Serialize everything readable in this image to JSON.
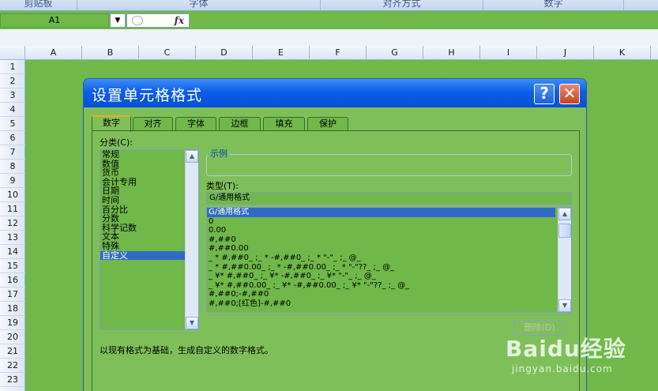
{
  "ribbon": {
    "groups": [
      "剪贴板",
      "字体",
      "对齐方式",
      "数字"
    ]
  },
  "formula_bar": {
    "name_box": "A1",
    "dropdown_icon": "▼",
    "fx_label": "fx"
  },
  "sheet": {
    "columns": [
      "A",
      "B",
      "C",
      "D",
      "E",
      "F",
      "G",
      "H",
      "I",
      "J",
      "K"
    ],
    "rows": [
      "1",
      "2",
      "3",
      "4",
      "5",
      "6",
      "7",
      "8",
      "9",
      "10",
      "11",
      "12",
      "13",
      "14",
      "15",
      "16",
      "17",
      "18",
      "19",
      "20",
      "21",
      "22",
      "23"
    ]
  },
  "dialog": {
    "title": "设置单元格格式",
    "help_icon": "?",
    "close_icon": "✕",
    "tabs": [
      "数字",
      "对齐",
      "字体",
      "边框",
      "填充",
      "保护"
    ],
    "category_label": "分类(C):",
    "categories": [
      "常规",
      "数值",
      "货币",
      "会计专用",
      "日期",
      "时间",
      "百分比",
      "分数",
      "科学记数",
      "文本",
      "特殊",
      "自定义"
    ],
    "selected_category": "自定义",
    "sample_label": "示例",
    "type_label": "类型(T):",
    "type_value": "G/通用格式",
    "formats": [
      "G/通用格式",
      "0",
      "0.00",
      "#,##0",
      "#,##0.00",
      "_ * #,##0_ ;_ * -#,##0_ ;_ * \"-\"_ ;_ @_",
      "_ * #,##0.00_ ;_ * -#,##0.00_ ;_ * \"-\"??_ ;_ @_",
      "_ ¥* #,##0_ ;_ ¥* -#,##0_ ;_ ¥* \"-\"_ ;_ @_",
      "_ ¥* #,##0.00_ ;_ ¥* -#,##0.00_ ;_ ¥* \"-\"??_ ;_ @_",
      "#,##0;-#,##0",
      "#,##0;[红色]-#,##0"
    ],
    "delete_button": "删除(D)",
    "description": "以现有格式为基础，生成自定义的数字格式。",
    "scroll_up_icon": "▲",
    "scroll_down_icon": "▼"
  },
  "watermark": {
    "main": "Baidu经验",
    "sub": "jingyan.baidu.com"
  }
}
